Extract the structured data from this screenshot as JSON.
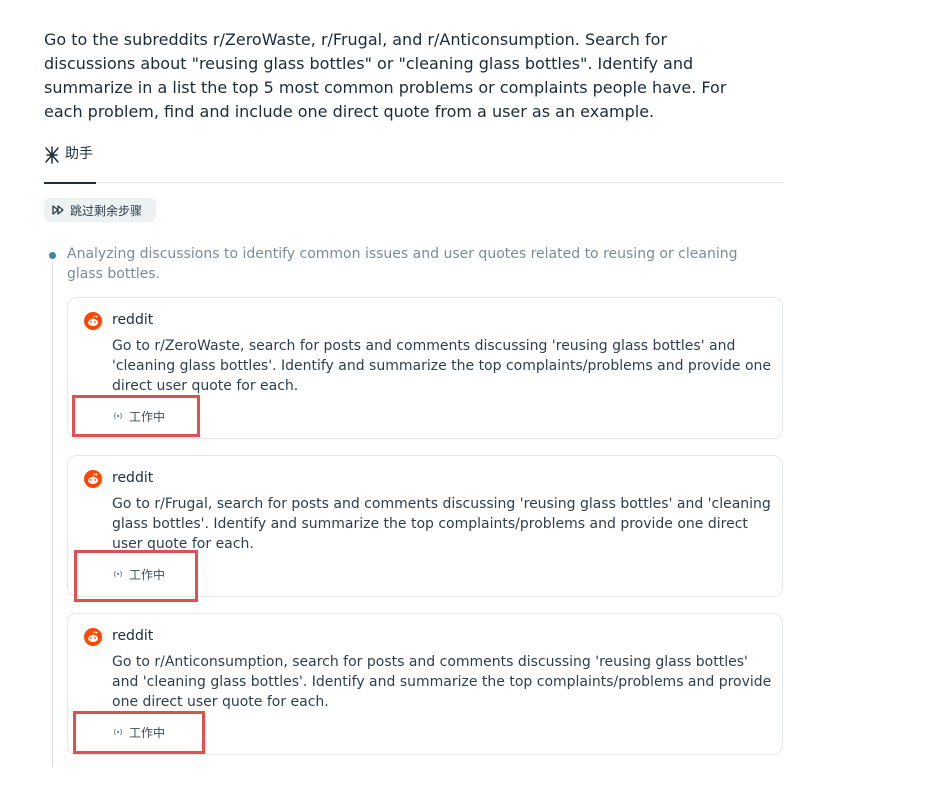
{
  "query": "Go to the subreddits r/ZeroWaste, r/Frugal, and r/Anticonsumption. Search for discussions about \"reusing glass bottles\" or \"cleaning glass bottles\". Identify and summarize in a list the top 5 most common problems or complaints people have. For each problem, find and include one direct quote from a user as an example.",
  "tab": {
    "label": "助手",
    "icon": "sparkle-agent-icon"
  },
  "skip_button": {
    "label": "跳过剩余步骤",
    "icon": "fast-forward-icon"
  },
  "step": {
    "description": "Analyzing discussions to identify common issues and user quotes related to reusing or cleaning glass bottles."
  },
  "tasks": [
    {
      "source": "reddit",
      "text": "Go to r/ZeroWaste, search for posts and comments discussing 'reusing glass bottles' and 'cleaning glass bottles'. Identify and summarize the top complaints/problems and provide one direct user quote for each.",
      "status": "工作中"
    },
    {
      "source": "reddit",
      "text": "Go to r/Frugal, search for posts and comments discussing 'reusing glass bottles' and 'cleaning glass bottles'. Identify and summarize the top complaints/problems and provide one direct user quote for each.",
      "status": "工作中"
    },
    {
      "source": "reddit",
      "text": "Go to r/Anticonsumption, search for posts and comments discussing 'reusing glass bottles' and 'cleaning glass bottles'. Identify and summarize the top complaints/problems and provide one direct user quote for each.",
      "status": "工作中"
    }
  ],
  "colors": {
    "reddit_orange": "#ff4500",
    "highlight_red": "#e05052",
    "timeline_dot": "#3f87a6"
  }
}
